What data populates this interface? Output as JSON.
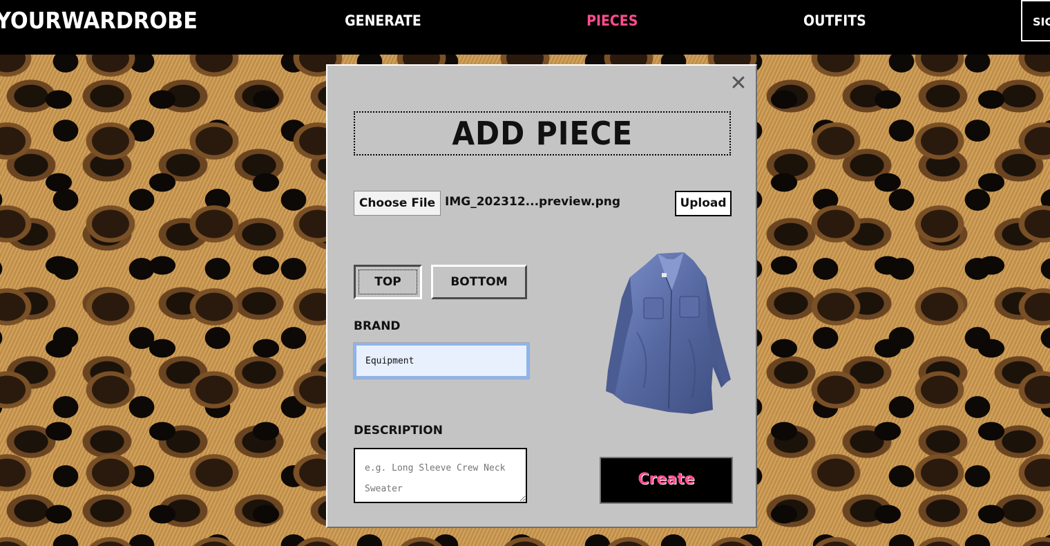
{
  "nav": {
    "logo": "YOURWARDROBE",
    "links": [
      "GENERATE",
      "PIECES",
      "OUTFITS"
    ],
    "active": "PIECES",
    "signin": "SIGN IN",
    "accent": "#ff4d8d"
  },
  "modal": {
    "close_icon": "close-icon",
    "title": "ADD PIECE",
    "file": {
      "choose_label": "Choose File",
      "file_name": "IMG_202312...preview.png",
      "upload_label": "Upload"
    },
    "type": {
      "options": [
        "TOP",
        "BOTTOM"
      ],
      "selected": "TOP"
    },
    "brand": {
      "label": "BRAND",
      "value": "Equipment"
    },
    "description": {
      "label": "DESCRIPTION",
      "placeholder": "e.g. Long Sleeve Crew Neck Sweater"
    },
    "create_label": "Create",
    "preview_image": "blue-button-up-shirt"
  }
}
